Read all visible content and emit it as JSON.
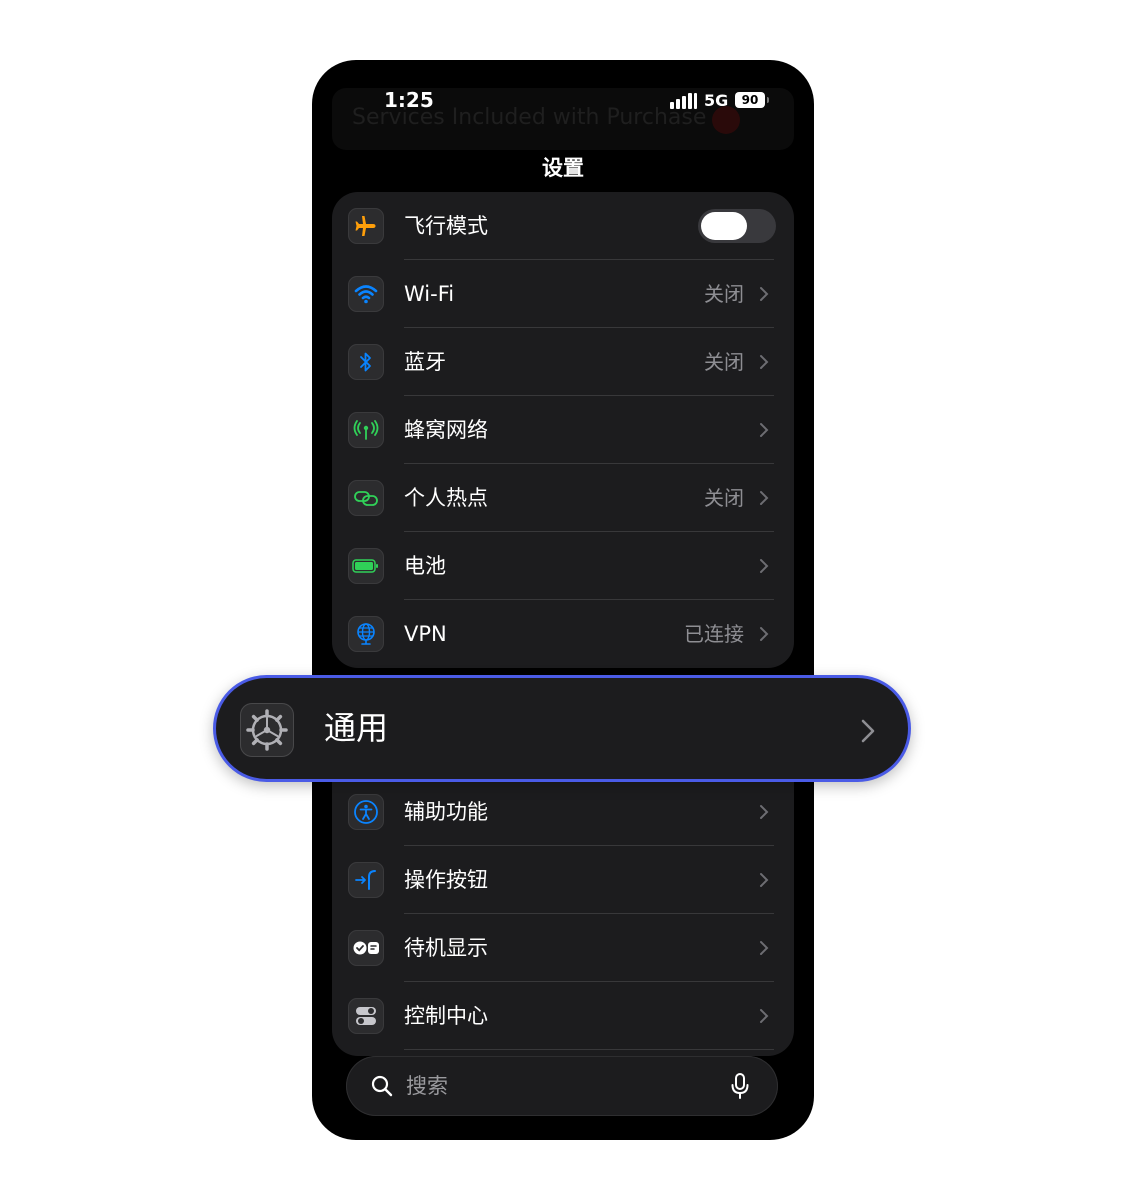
{
  "status_bar": {
    "time": "1:25",
    "network": "5G",
    "battery": "90"
  },
  "ghost_banner": "Services Included with Purchase",
  "header": {
    "title": "设置"
  },
  "connectivity": [
    {
      "label": "飞行模式",
      "icon": "airplane-icon",
      "toggle": "off",
      "accent": "#ff9f0a"
    },
    {
      "label": "Wi-Fi",
      "value": "关闭",
      "icon": "wifi-icon",
      "accent": "#0a84ff"
    },
    {
      "label": "蓝牙",
      "value": "关闭",
      "icon": "bluetooth-icon",
      "accent": "#0a84ff"
    },
    {
      "label": "蜂窝网络",
      "value": "",
      "icon": "cellular-icon",
      "accent": "#30d158"
    },
    {
      "label": "个人热点",
      "value": "关闭",
      "icon": "hotspot-icon",
      "accent": "#30d158"
    },
    {
      "label": "电池",
      "value": "",
      "icon": "battery-icon",
      "accent": "#30d158"
    },
    {
      "label": "VPN",
      "value": "已连接",
      "icon": "globe-icon",
      "accent": "#0a84ff"
    }
  ],
  "highlighted": {
    "label": "通用",
    "icon": "gear-icon",
    "border": "#4a5be6"
  },
  "system": [
    {
      "label": "辅助功能",
      "icon": "accessibility-icon"
    },
    {
      "label": "操作按钮",
      "icon": "action-button-icon"
    },
    {
      "label": "待机显示",
      "icon": "standby-icon"
    },
    {
      "label": "控制中心",
      "icon": "control-center-icon"
    }
  ],
  "search": {
    "placeholder": "搜索"
  }
}
